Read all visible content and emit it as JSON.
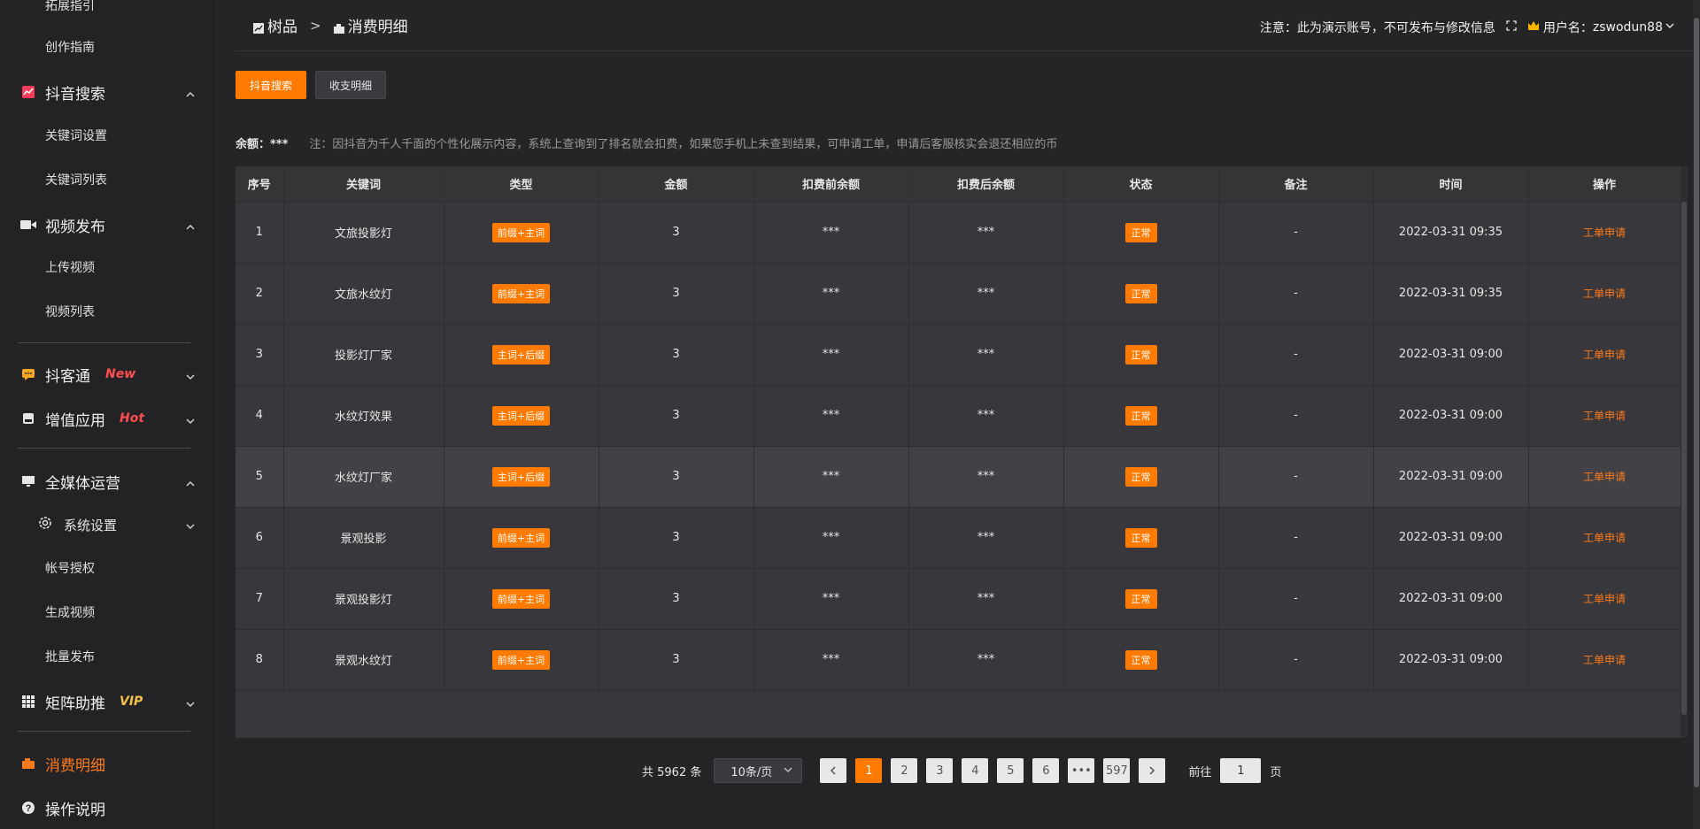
{
  "sidebar": {
    "top_item": "拓展指引",
    "items": [
      {
        "label": "创作指南"
      },
      {
        "label": "抖音搜索"
      },
      {
        "label": "关键词设置"
      },
      {
        "label": "关键词列表"
      },
      {
        "label": "视频发布"
      },
      {
        "label": "上传视频"
      },
      {
        "label": "视频列表"
      },
      {
        "label": "抖客通",
        "tag": "New"
      },
      {
        "label": "增值应用",
        "tag": "Hot"
      },
      {
        "label": "全媒体运营"
      },
      {
        "label": "系统设置"
      },
      {
        "label": "帐号授权"
      },
      {
        "label": "生成视频"
      },
      {
        "label": "批量发布"
      },
      {
        "label": "矩阵助推",
        "tag": "VIP"
      },
      {
        "label": "消费明细"
      },
      {
        "label": "操作说明"
      }
    ]
  },
  "header": {
    "crumb_root": "树品",
    "crumb_sep": ">",
    "crumb_current": "消费明细",
    "notice": "注意：此为演示账号，不可发布与修改信息",
    "user_prefix": "用户名：",
    "username": "zswodun88"
  },
  "tabs": {
    "douyin": "抖音搜索",
    "income": "收支明细"
  },
  "balance": {
    "label": "余额：***",
    "note": "注：因抖音为千人千面的个性化展示内容，系统上查询到了排名就会扣费，如果您手机上未查到结果，可申请工单，申请后客服核实会退还相应的币"
  },
  "table": {
    "columns": [
      "序号",
      "关键词",
      "类型",
      "金额",
      "扣费前余额",
      "扣费后余额",
      "状态",
      "备注",
      "时间",
      "操作"
    ],
    "rows": [
      {
        "no": "1",
        "keyword": "文旅投影灯",
        "type": "前缀+主词",
        "amount": "3",
        "before": "***",
        "after": "***",
        "status": "正常",
        "remark": "-",
        "time": "2022-03-31 09:35",
        "action": "工单申请"
      },
      {
        "no": "2",
        "keyword": "文旅水纹灯",
        "type": "前缀+主词",
        "amount": "3",
        "before": "***",
        "after": "***",
        "status": "正常",
        "remark": "-",
        "time": "2022-03-31 09:35",
        "action": "工单申请"
      },
      {
        "no": "3",
        "keyword": "投影灯厂家",
        "type": "主词+后缀",
        "amount": "3",
        "before": "***",
        "after": "***",
        "status": "正常",
        "remark": "-",
        "time": "2022-03-31 09:00",
        "action": "工单申请"
      },
      {
        "no": "4",
        "keyword": "水纹灯效果",
        "type": "主词+后缀",
        "amount": "3",
        "before": "***",
        "after": "***",
        "status": "正常",
        "remark": "-",
        "time": "2022-03-31 09:00",
        "action": "工单申请"
      },
      {
        "no": "5",
        "keyword": "水纹灯厂家",
        "type": "主词+后缀",
        "amount": "3",
        "before": "***",
        "after": "***",
        "status": "正常",
        "remark": "-",
        "time": "2022-03-31 09:00",
        "action": "工单申请"
      },
      {
        "no": "6",
        "keyword": "景观投影",
        "type": "前缀+主词",
        "amount": "3",
        "before": "***",
        "after": "***",
        "status": "正常",
        "remark": "-",
        "time": "2022-03-31 09:00",
        "action": "工单申请"
      },
      {
        "no": "7",
        "keyword": "景观投影灯",
        "type": "前缀+主词",
        "amount": "3",
        "before": "***",
        "after": "***",
        "status": "正常",
        "remark": "-",
        "time": "2022-03-31 09:00",
        "action": "工单申请"
      },
      {
        "no": "8",
        "keyword": "景观水纹灯",
        "type": "前缀+主词",
        "amount": "3",
        "before": "***",
        "after": "***",
        "status": "正常",
        "remark": "-",
        "time": "2022-03-31 09:00",
        "action": "工单申请"
      }
    ]
  },
  "pagination": {
    "total": "共 5962 条",
    "page_size": "10条/页",
    "pages": [
      "1",
      "2",
      "3",
      "4",
      "5",
      "6",
      "•••",
      "597"
    ],
    "current": "1",
    "goto_label": "前往",
    "goto_value": "1",
    "goto_suffix": "页"
  },
  "colors": {
    "accent": "#ff7a00",
    "tag_new": "#ff4d4f",
    "tag_vip": "#f5c04a"
  }
}
